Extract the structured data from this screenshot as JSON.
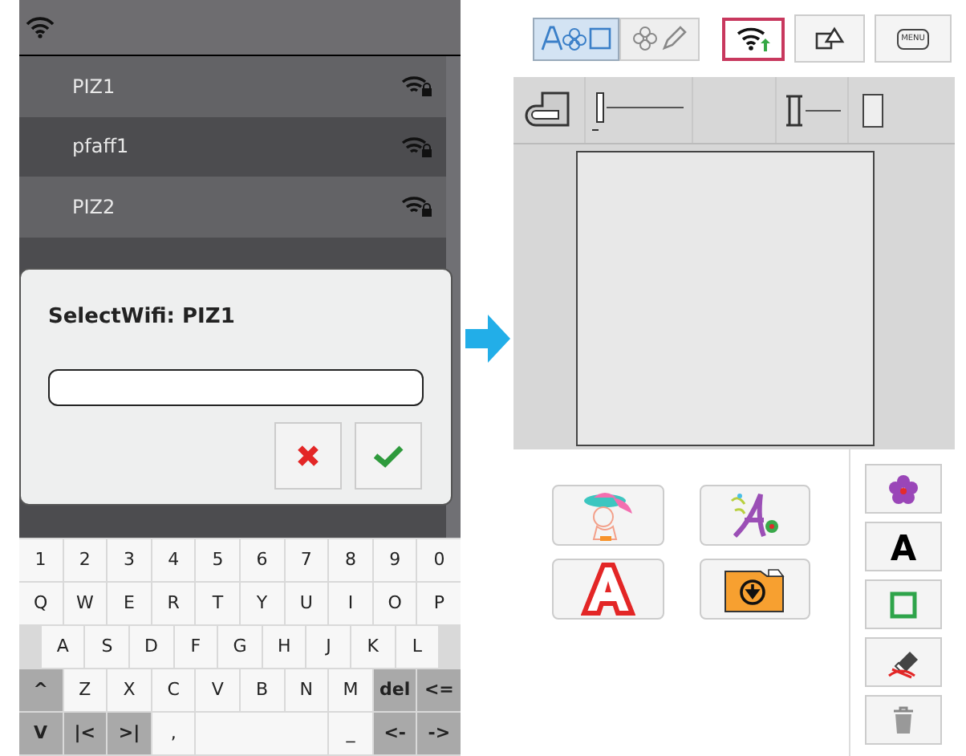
{
  "wifi_list": {
    "networks": [
      {
        "name": "PIZ1"
      },
      {
        "name": "pfaff1"
      },
      {
        "name": "PIZ2"
      }
    ]
  },
  "dialog": {
    "title": "SelectWifi: PIZ1"
  },
  "keyboard": {
    "rows": [
      [
        {
          "label": "1",
          "kind": "char"
        },
        {
          "label": "2",
          "kind": "char"
        },
        {
          "label": "3",
          "kind": "char"
        },
        {
          "label": "4",
          "kind": "char"
        },
        {
          "label": "5",
          "kind": "char"
        },
        {
          "label": "6",
          "kind": "char"
        },
        {
          "label": "7",
          "kind": "char"
        },
        {
          "label": "8",
          "kind": "char"
        },
        {
          "label": "9",
          "kind": "char"
        },
        {
          "label": "0",
          "kind": "char"
        }
      ],
      [
        {
          "label": "Q",
          "kind": "char"
        },
        {
          "label": "W",
          "kind": "char"
        },
        {
          "label": "E",
          "kind": "char"
        },
        {
          "label": "R",
          "kind": "char"
        },
        {
          "label": "T",
          "kind": "char"
        },
        {
          "label": "Y",
          "kind": "char"
        },
        {
          "label": "U",
          "kind": "char"
        },
        {
          "label": "I",
          "kind": "char"
        },
        {
          "label": "O",
          "kind": "char"
        },
        {
          "label": "P",
          "kind": "char"
        }
      ],
      [
        {
          "label": "A",
          "kind": "char"
        },
        {
          "label": "S",
          "kind": "char"
        },
        {
          "label": "D",
          "kind": "char"
        },
        {
          "label": "F",
          "kind": "char"
        },
        {
          "label": "G",
          "kind": "char"
        },
        {
          "label": "H",
          "kind": "char"
        },
        {
          "label": "J",
          "kind": "char"
        },
        {
          "label": "K",
          "kind": "char"
        },
        {
          "label": "L",
          "kind": "char"
        }
      ],
      [
        {
          "label": "^",
          "kind": "function"
        },
        {
          "label": "Z",
          "kind": "char"
        },
        {
          "label": "X",
          "kind": "char"
        },
        {
          "label": "C",
          "kind": "char"
        },
        {
          "label": "V",
          "kind": "char"
        },
        {
          "label": "B",
          "kind": "char"
        },
        {
          "label": "N",
          "kind": "char"
        },
        {
          "label": "M",
          "kind": "char"
        },
        {
          "label": "del",
          "kind": "function"
        },
        {
          "label": "<=",
          "kind": "function"
        }
      ],
      [
        {
          "label": "V",
          "kind": "function"
        },
        {
          "label": "|<",
          "kind": "function"
        },
        {
          "label": ">|",
          "kind": "function"
        },
        {
          "label": ",",
          "kind": "char"
        },
        {
          "kind": "space"
        },
        {
          "kind": "space"
        },
        {
          "kind": "space"
        },
        {
          "label": "_",
          "kind": "char"
        },
        {
          "label": "<-",
          "kind": "function"
        },
        {
          "label": "->",
          "kind": "function"
        }
      ]
    ]
  },
  "mode_tabs": [
    {
      "kind": "edit",
      "selected": true
    },
    {
      "kind": "stitch",
      "selected": false
    }
  ],
  "toolbar": {
    "menu_label": "MENU"
  }
}
